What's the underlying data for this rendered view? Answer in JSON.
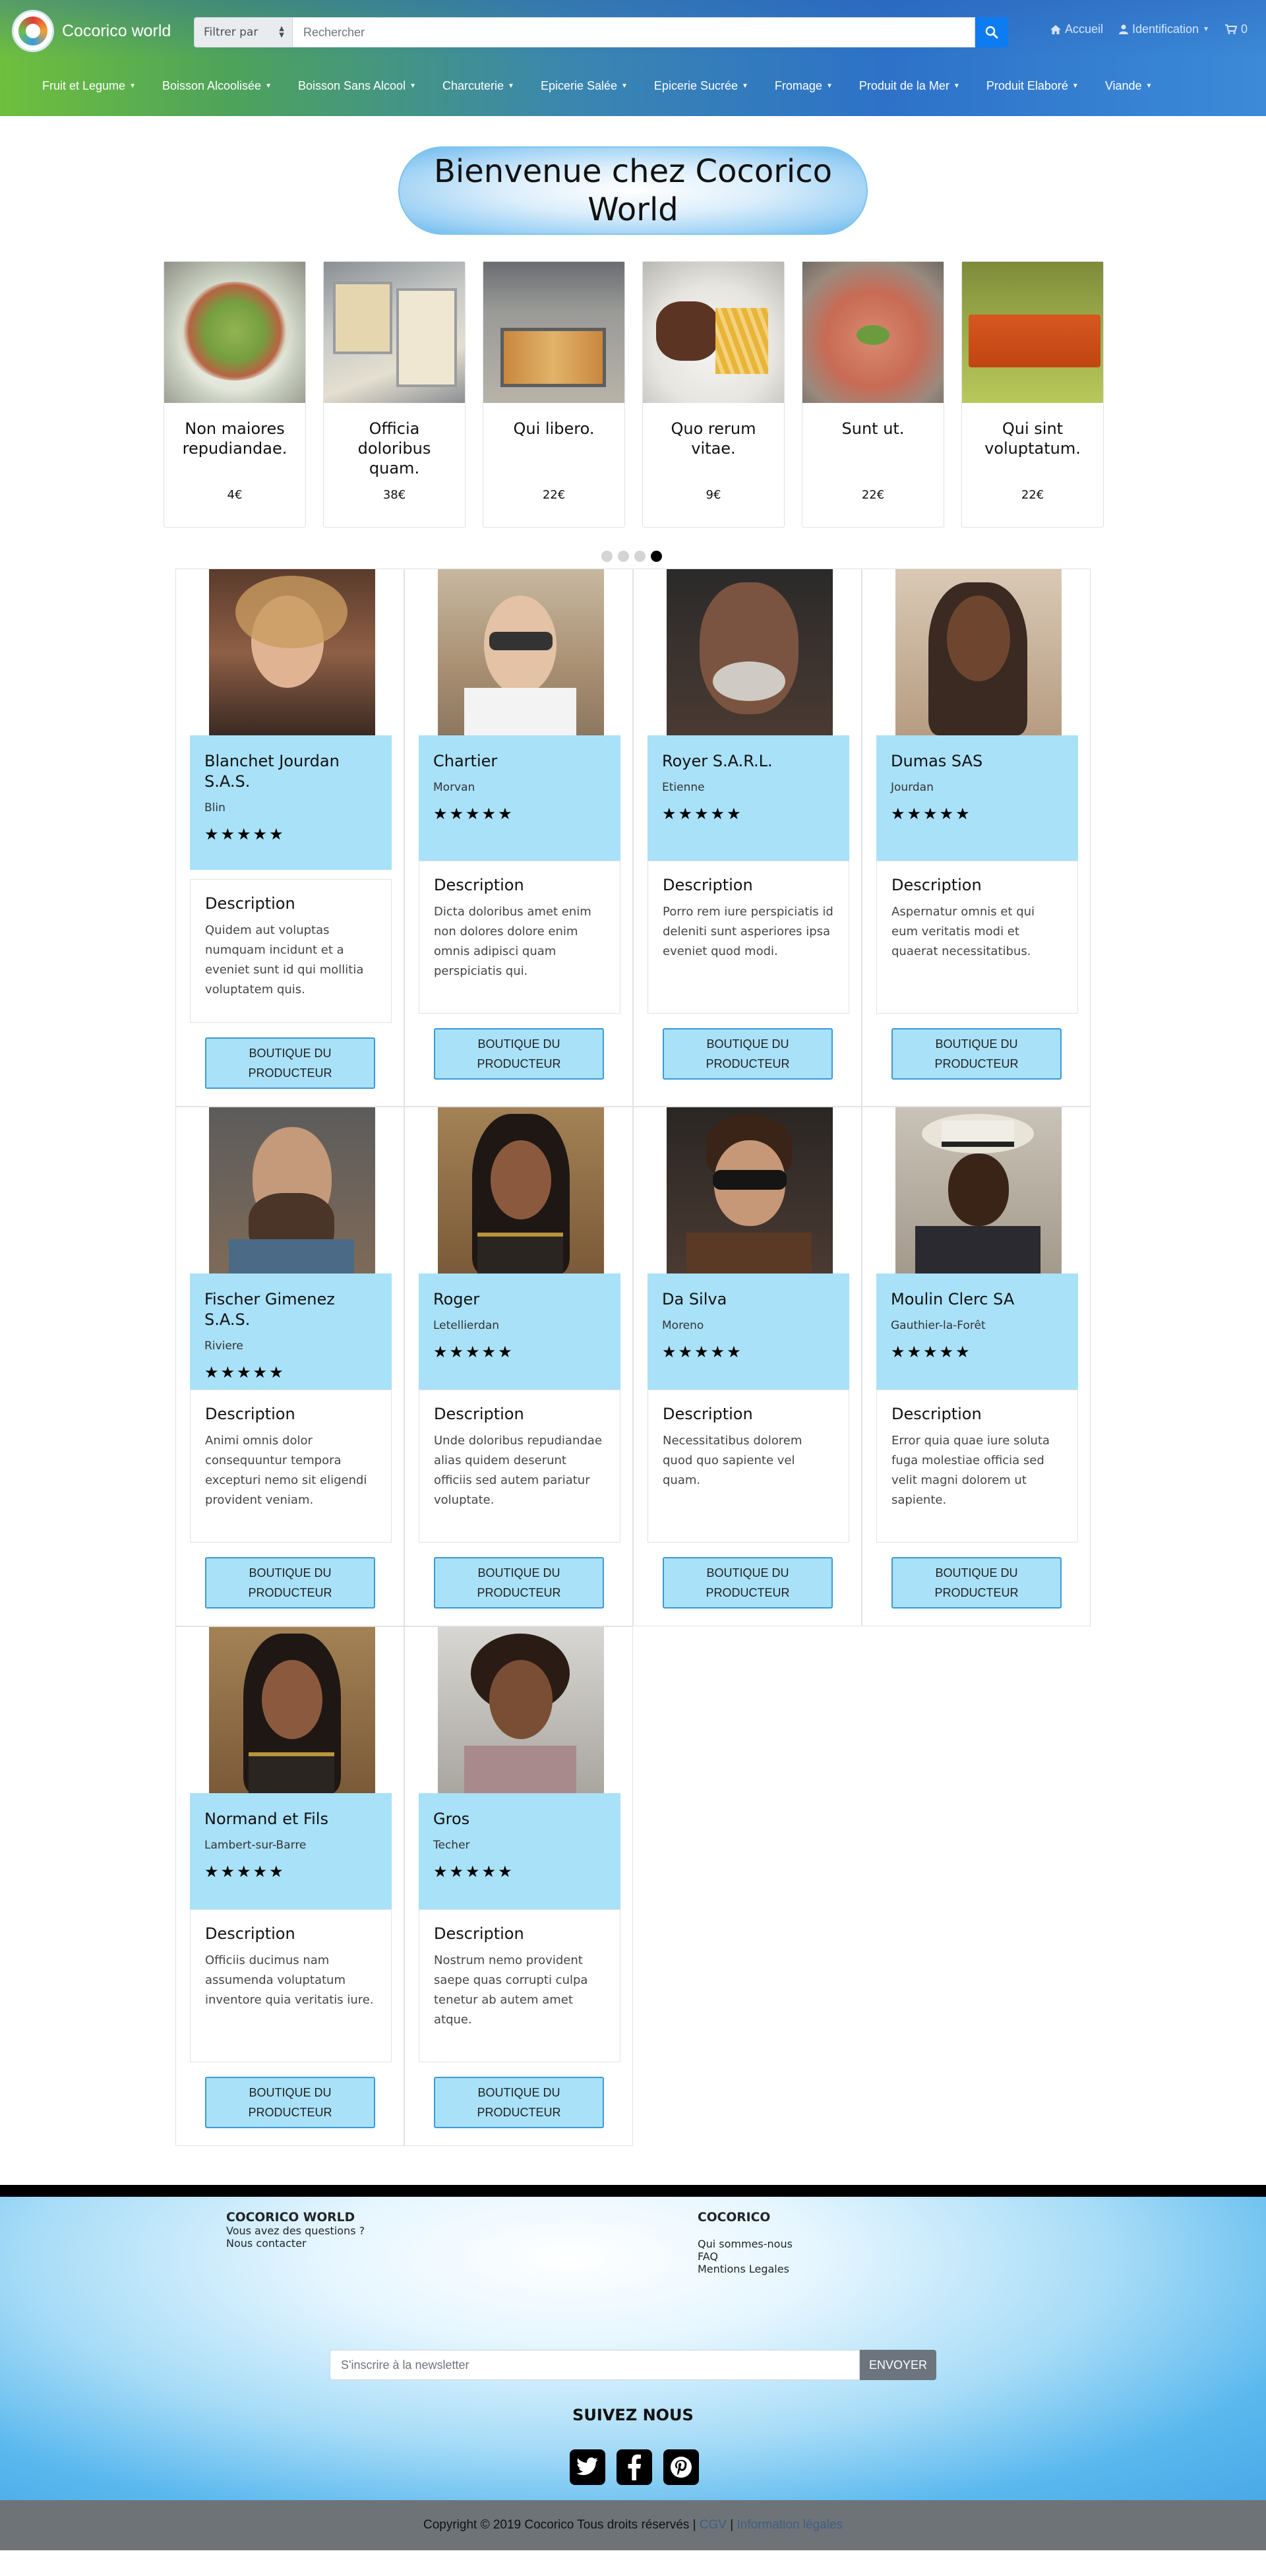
{
  "header": {
    "brand": "Cocorico world",
    "filter_label": "Filtrer par",
    "search_placeholder": "Rechercher",
    "nav": [
      {
        "label": "Accueil",
        "icon": "home-icon"
      },
      {
        "label": "Identification",
        "icon": "user-icon"
      },
      {
        "label": "0",
        "icon": "cart-icon"
      }
    ],
    "categories": [
      "Fruit et Legume",
      "Boisson Alcoolisée",
      "Boisson Sans Alcool",
      "Charcuterie",
      "Epicerie Salée",
      "Epicerie Sucrée",
      "Fromage",
      "Produit de la Mer",
      "Produit Elaboré",
      "Viande"
    ]
  },
  "hero": {
    "title": "Bienvenue chez Cocorico World"
  },
  "carousel": {
    "items": [
      {
        "name": "Non maiores repudiandae.",
        "price": "4€"
      },
      {
        "name": "Officia doloribus quam.",
        "price": "38€"
      },
      {
        "name": "Qui libero.",
        "price": "22€"
      },
      {
        "name": "Quo rerum vitae.",
        "price": "9€"
      },
      {
        "name": "Sunt ut.",
        "price": "22€"
      },
      {
        "name": "Qui sint voluptatum.",
        "price": "22€"
      }
    ],
    "active_dot": 3,
    "dot_count": 4
  },
  "producers": [
    {
      "name": "Blanchet Jourdan S.A.S.",
      "city": "Blin",
      "description": "Quidem aut voluptas numquam incidunt et a eveniet sunt id qui mollitia voluptatem quis.",
      "rating": 5
    },
    {
      "name": "Chartier",
      "city": "Morvan",
      "description": "Dicta doloribus amet enim non dolores dolore enim omnis adipisci quam perspiciatis qui.",
      "rating": 5
    },
    {
      "name": "Royer S.A.R.L.",
      "city": "Etienne",
      "description": "Porro rem iure perspiciatis id deleniti sunt asperiores ipsa eveniet quod modi.",
      "rating": 5
    },
    {
      "name": "Dumas SAS",
      "city": "Jourdan",
      "description": "Aspernatur omnis et qui eum veritatis modi et quaerat necessitatibus.",
      "rating": 5
    },
    {
      "name": "Fischer Gimenez S.A.S.",
      "city": "Riviere",
      "description": "Animi omnis dolor consequuntur tempora excepturi nemo sit eligendi provident veniam.",
      "rating": 5
    },
    {
      "name": "Roger",
      "city": "Letellierdan",
      "description": "Unde doloribus repudiandae alias quidem deserunt officiis sed autem pariatur voluptate.",
      "rating": 5
    },
    {
      "name": "Da Silva",
      "city": "Moreno",
      "description": "Necessitatibus dolorem quod quo sapiente vel quam.",
      "rating": 5
    },
    {
      "name": "Moulin Clerc SA",
      "city": "Gauthier-la-Forêt",
      "description": "Error quia quae iure soluta fuga molestiae officia sed velit magni dolorem ut sapiente.",
      "rating": 5
    },
    {
      "name": "Normand et Fils",
      "city": "Lambert-sur-Barre",
      "description": "Officiis ducimus nam assumenda voluptatum inventore quia veritatis iure.",
      "rating": 5
    },
    {
      "name": "Gros",
      "city": "Techer",
      "description": "Nostrum nemo provident saepe quas corrupti culpa tenetur ab autem amet atque.",
      "rating": 5
    }
  ],
  "producer_labels": {
    "description": "Description",
    "button": "BOUTIQUE DU PRODUCTEUR",
    "stars": "★★★★★"
  },
  "footer": {
    "col1_title": "COCORICO WORLD",
    "col1_question": "Vous avez des questions ?",
    "col1_contact": "Nous contacter",
    "col2_title": "COCORICO",
    "col2_links": [
      "Qui sommes-nous",
      "FAQ",
      "Mentions Legales"
    ],
    "newsletter_placeholder": "S'inscrire à la newsletter",
    "newsletter_button": "ENVOYER",
    "follow_title": "SUIVEZ NOUS",
    "socials": [
      "twitter-icon",
      "facebook-icon",
      "pinterest-icon"
    ],
    "copyright": "Copyright © 2019 Cocorico Tous droits réservés |",
    "cgv": "CGV",
    "sep": "|",
    "legal": "Information légales"
  }
}
